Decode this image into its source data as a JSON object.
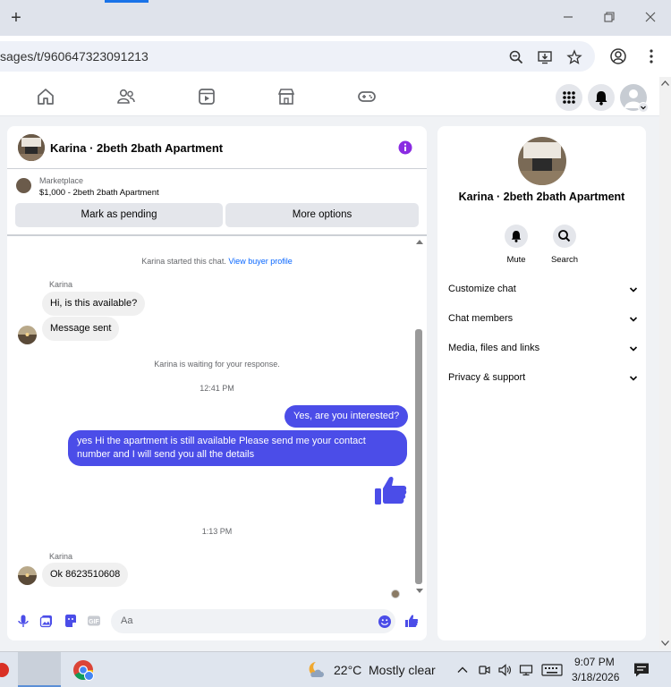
{
  "browser": {
    "url": "sages/t/960647323091213",
    "new_tab": "+"
  },
  "chat": {
    "title": "Karina · 2beth 2bath Apartment",
    "marketplace": {
      "category": "Marketplace",
      "listing": "$1,000 - 2beth 2bath Apartment",
      "btn_pending": "Mark as pending",
      "btn_more": "More options"
    },
    "started_prefix": "Karina started this chat.",
    "started_link": "View buyer profile",
    "sender_name_1": "Karina",
    "msg_in_1": "Hi, is this available?",
    "msg_in_2": "Message sent",
    "waiting": "Karina is waiting for your response.",
    "time_1": "12:41 PM",
    "msg_out_1": "Yes, are you interested?",
    "msg_out_2": "yes Hi the apartment is still available Please send me your contact number and I will send you all the details",
    "time_2": "1:13 PM",
    "sender_name_2": "Karina",
    "msg_in_3": "Ok 8623510608",
    "composer_placeholder": "Aa"
  },
  "info_panel": {
    "title": "Karina · 2beth 2bath Apartment",
    "mute_label": "Mute",
    "search_label": "Search",
    "menu": [
      {
        "label": "Customize chat"
      },
      {
        "label": "Chat members"
      },
      {
        "label": "Media, files and links"
      },
      {
        "label": "Privacy & support"
      }
    ]
  },
  "taskbar": {
    "temperature": "22°C",
    "weather": "Mostly clear",
    "time": "9:07 PM",
    "date": "3/18/2026"
  },
  "colors": {
    "accent": "#4b4de8",
    "link": "#0866ff",
    "info_purple": "#8a2be2"
  }
}
